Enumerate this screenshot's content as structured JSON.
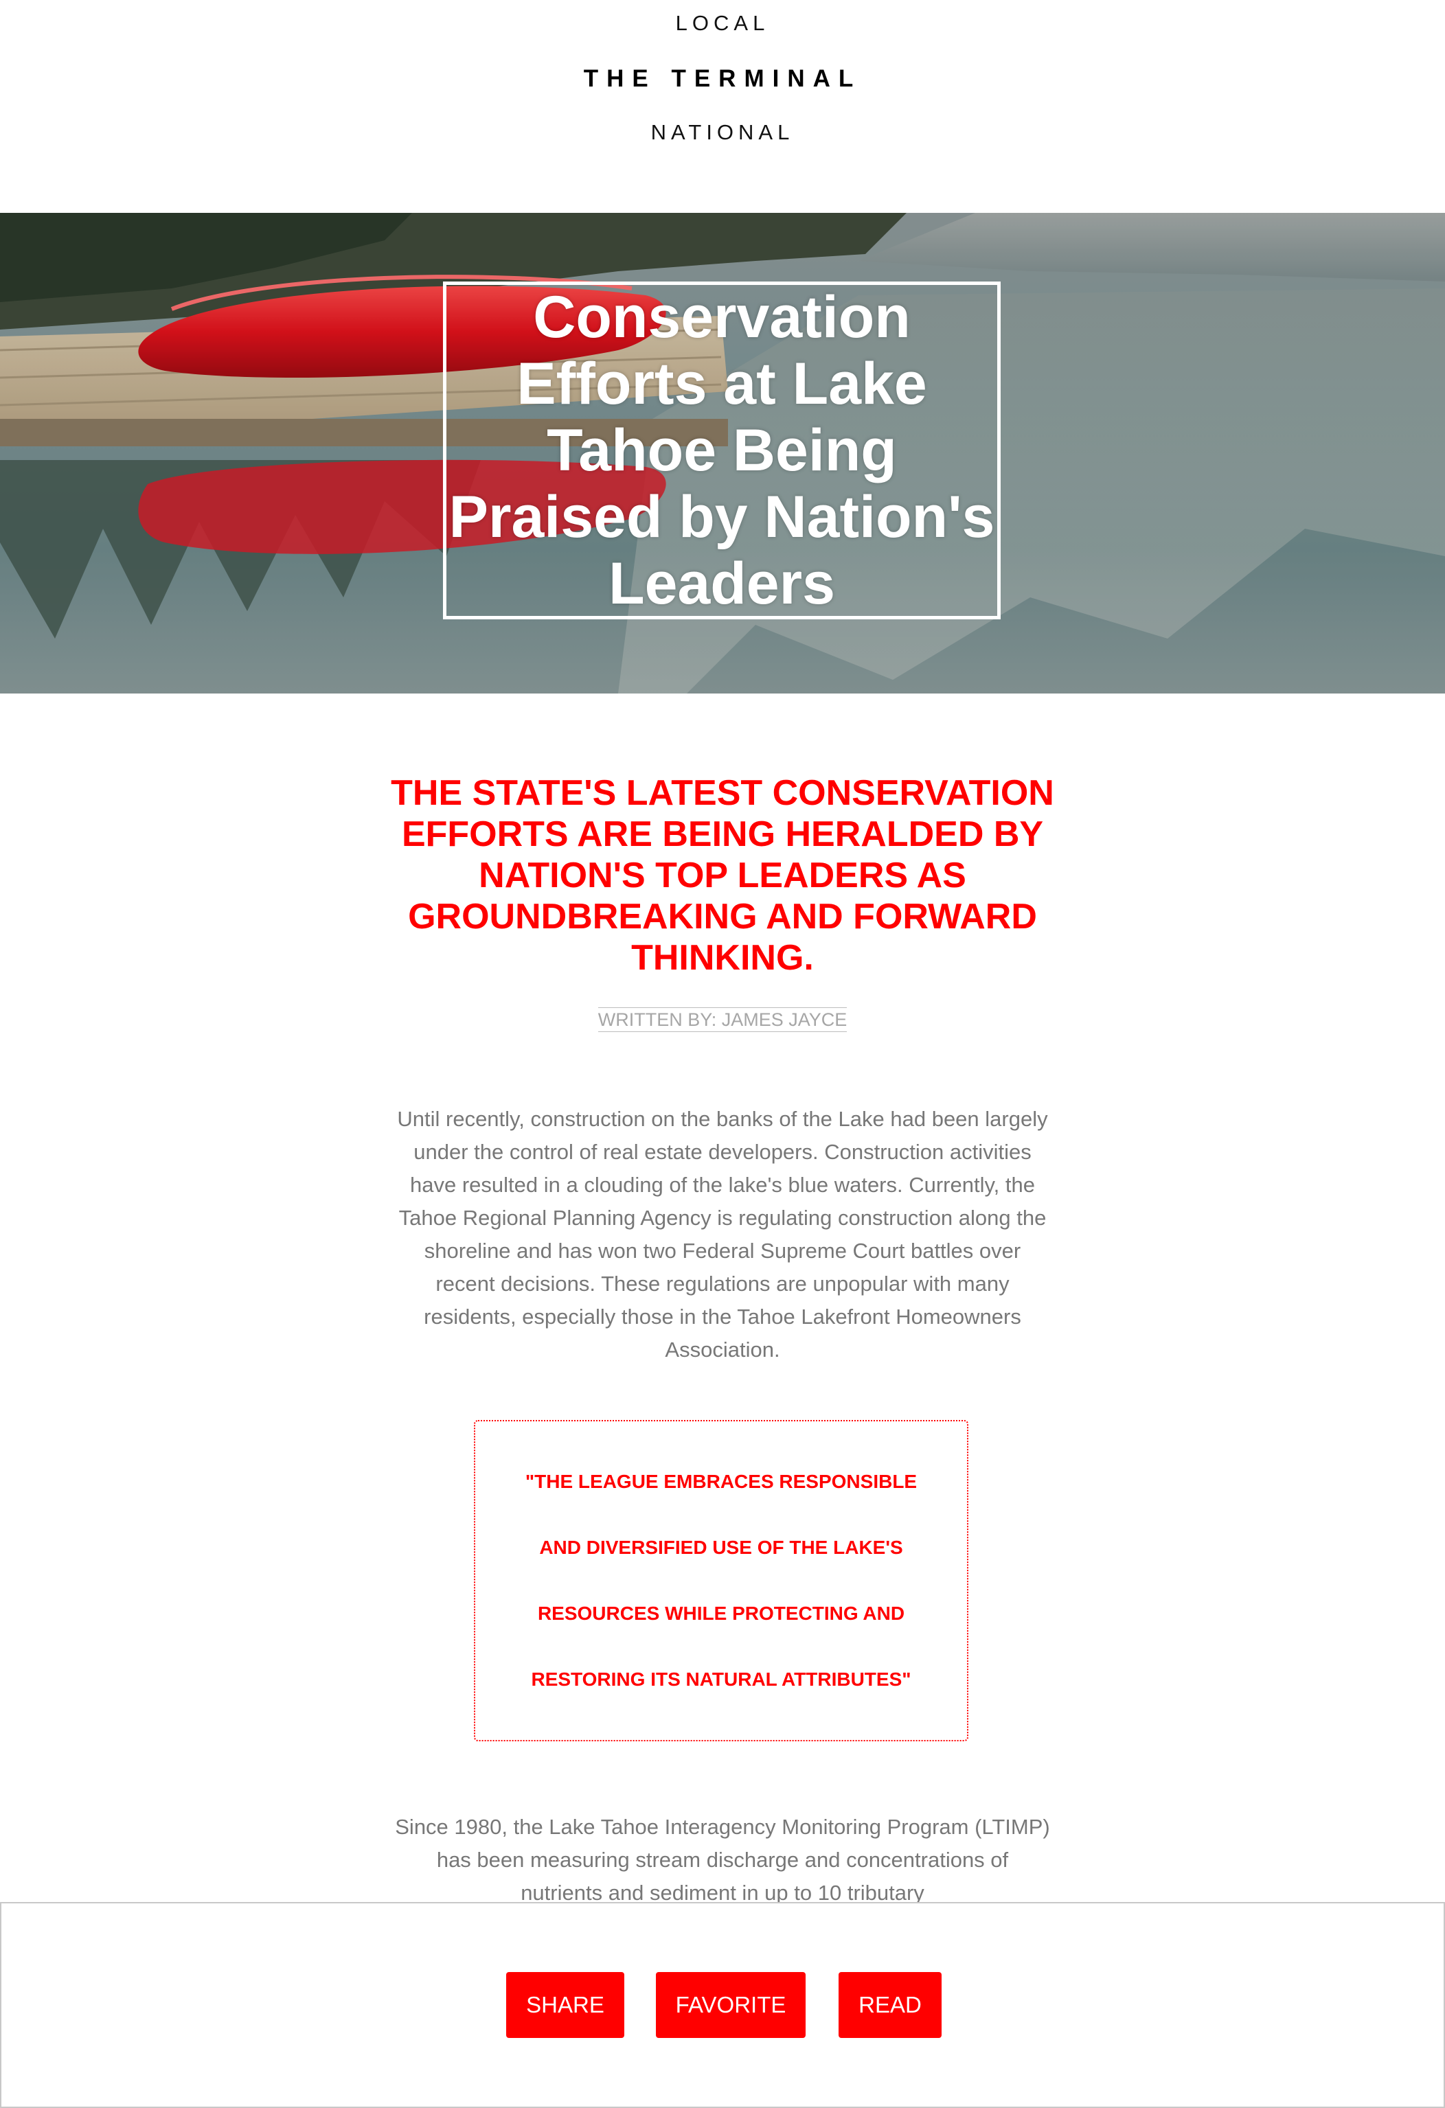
{
  "nav": {
    "local": "LOCAL",
    "brand": "THE TERMINAL",
    "national": "NATIONAL"
  },
  "hero": {
    "title": "Conservation Efforts at Lake Tahoe Being Praised by Nation's Leaders",
    "image": "lake with red canoes on a wooden dock, pine forest and mountain reflection"
  },
  "article": {
    "subheadline": "THE STATE'S LATEST CONSERVATION EFFORTS ARE BEING HERALDED BY NATION'S TOP LEADERS AS GROUNDBREAKING AND FORWARD THINKING.",
    "byline": "WRITTEN BY: JAMES JAYCE",
    "paragraph1": "Until recently, construction on the banks of the Lake had been largely under the control of real estate developers. Construction activities have resulted in a clouding of the lake's blue waters. Currently, the Tahoe Regional Planning Agency is regulating construction along the shoreline and has won two Federal Supreme Court battles over recent decisions. These regulations are unpopular with many residents, especially those in the Tahoe Lakefront Homeowners Association.",
    "quote": "\"THE LEAGUE EMBRACES RESPONSIBLE AND DIVERSIFIED USE OF THE LAKE'S RESOURCES WHILE PROTECTING AND RESTORING ITS NATURAL ATTRIBUTES\"",
    "paragraph2": "Since 1980, the Lake Tahoe Interagency Monitoring Program (LTIMP) has been measuring stream discharge and concentrations of nutrients and sediment in up to 10 tributary"
  },
  "actions": {
    "share": "SHARE",
    "favorite": "FAVORITE",
    "read": "READ"
  },
  "colors": {
    "accent": "#ff0000",
    "body_text": "#777777",
    "byline": "#a6a6a6"
  }
}
